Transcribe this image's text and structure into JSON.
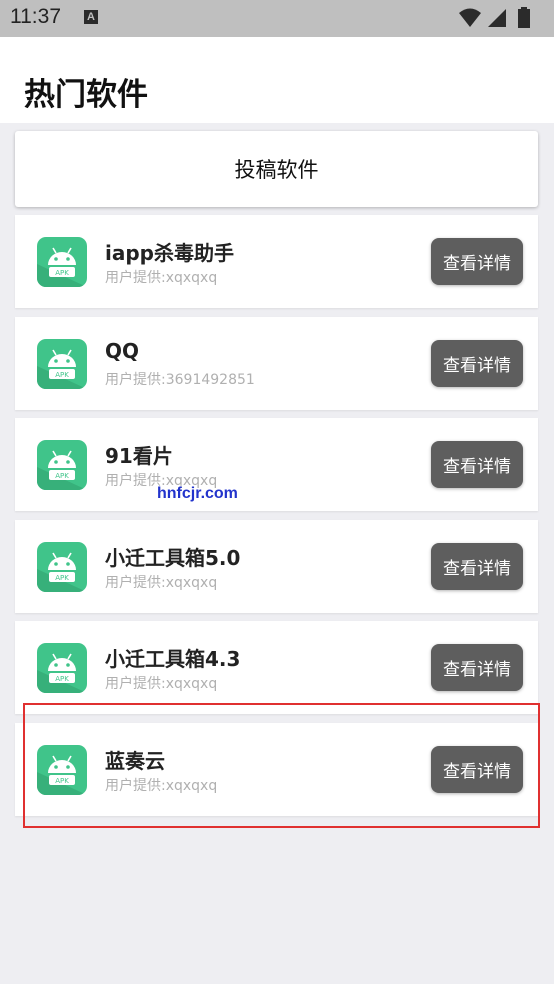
{
  "status_bar": {
    "time": "11:37",
    "a_icon_letter": "A"
  },
  "header": {
    "title": "热门软件"
  },
  "submit_button": {
    "label": "投稿软件"
  },
  "apps": [
    {
      "name": "iapp杀毒助手",
      "provider": "用户提供:xqxqxq",
      "button": "查看详情"
    },
    {
      "name": "QQ",
      "provider": "用户提供:3691492851",
      "button": "查看详情"
    },
    {
      "name": "91看片",
      "provider": "用户提供:xqxqxq",
      "button": "查看详情"
    },
    {
      "name": "小迁工具箱5.0",
      "provider": "用户提供:xqxqxq",
      "button": "查看详情"
    },
    {
      "name": "小迁工具箱4.3",
      "provider": "用户提供:xqxqxq",
      "button": "查看详情"
    },
    {
      "name": "蓝奏云",
      "provider": "用户提供:xqxqxq",
      "button": "查看详情"
    }
  ],
  "icon_label": "APK",
  "watermark": "hnfcjr.com",
  "colors": {
    "accent_green": "#40c48a",
    "button_gray": "#5e5e5e",
    "highlight_red": "#e03030",
    "status_bar": "#bfbfbf"
  },
  "icons": {
    "wifi": "wifi-icon",
    "signal": "signal-icon",
    "battery": "battery-icon",
    "apk": "android-apk-icon"
  }
}
